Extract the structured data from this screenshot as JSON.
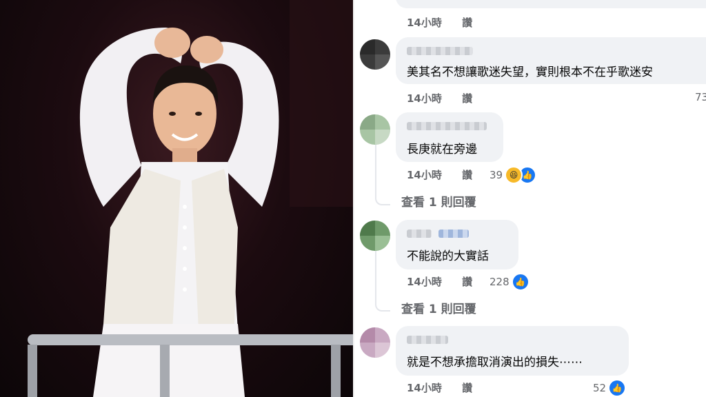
{
  "comments": [
    {
      "time": "14小時",
      "reply": "讚",
      "text": "",
      "count": ""
    },
    {
      "time": "14小時",
      "reply": "讚",
      "text": "美其名不想讓歌迷失望，實則根本不在乎歌迷安",
      "count": "73"
    },
    {
      "time": "14小時",
      "reply": "讚",
      "text": "長庚就在旁邊",
      "count": "39"
    },
    {
      "time": "14小時",
      "reply": "讚",
      "text": "不能說的大實話",
      "count": "228"
    },
    {
      "time": "14小時",
      "reply": "讚",
      "text": "就是不想承擔取消演出的損失⋯⋯",
      "count": "52"
    }
  ],
  "view_replies": [
    "查看 1 則回覆",
    "查看 1 則回覆"
  ],
  "colors": {
    "bubble": "#f0f2f5",
    "like": "#1877f2",
    "meta": "#65676b"
  }
}
